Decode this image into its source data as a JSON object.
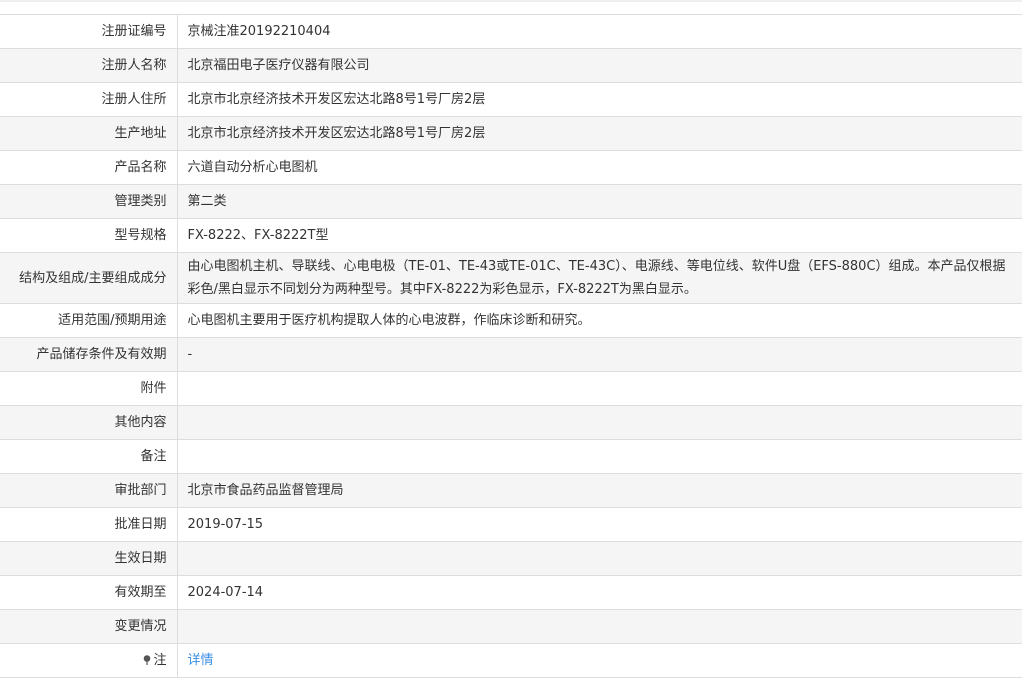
{
  "rows": [
    {
      "label": "注册证编号",
      "value": "京械注准20192210404"
    },
    {
      "label": "注册人名称",
      "value": "北京福田电子医疗仪器有限公司"
    },
    {
      "label": "注册人住所",
      "value": "北京市北京经济技术开发区宏达北路8号1号厂房2层"
    },
    {
      "label": "生产地址",
      "value": "北京市北京经济技术开发区宏达北路8号1号厂房2层"
    },
    {
      "label": "产品名称",
      "value": "六道自动分析心电图机"
    },
    {
      "label": "管理类别",
      "value": "第二类"
    },
    {
      "label": "型号规格",
      "value": "FX-8222、FX-8222T型"
    },
    {
      "label": "结构及组成/主要组成成分",
      "value": "由心电图机主机、导联线、心电电极（TE-01、TE-43或TE-01C、TE-43C）、电源线、等电位线、软件U盘（EFS-880C）组成。本产品仅根据彩色/黑白显示不同划分为两种型号。其中FX-8222为彩色显示，FX-8222T为黑白显示。"
    },
    {
      "label": "适用范围/预期用途",
      "value": "心电图机主要用于医疗机构提取人体的心电波群，作临床诊断和研究。"
    },
    {
      "label": "产品储存条件及有效期",
      "value": "-"
    },
    {
      "label": "附件",
      "value": ""
    },
    {
      "label": "其他内容",
      "value": ""
    },
    {
      "label": "备注",
      "value": ""
    },
    {
      "label": "审批部门",
      "value": "北京市食品药品监督管理局"
    },
    {
      "label": "批准日期",
      "value": "2019-07-15"
    },
    {
      "label": "生效日期",
      "value": ""
    },
    {
      "label": "有效期至",
      "value": "2024-07-14"
    },
    {
      "label": "变更情况",
      "value": ""
    }
  ],
  "note": {
    "label": "注",
    "link_text": "详情",
    "icon": "pin-icon"
  },
  "colors": {
    "link": "#3a8ee6",
    "alt_row": "#f5f5f5",
    "border": "#dddddd"
  }
}
